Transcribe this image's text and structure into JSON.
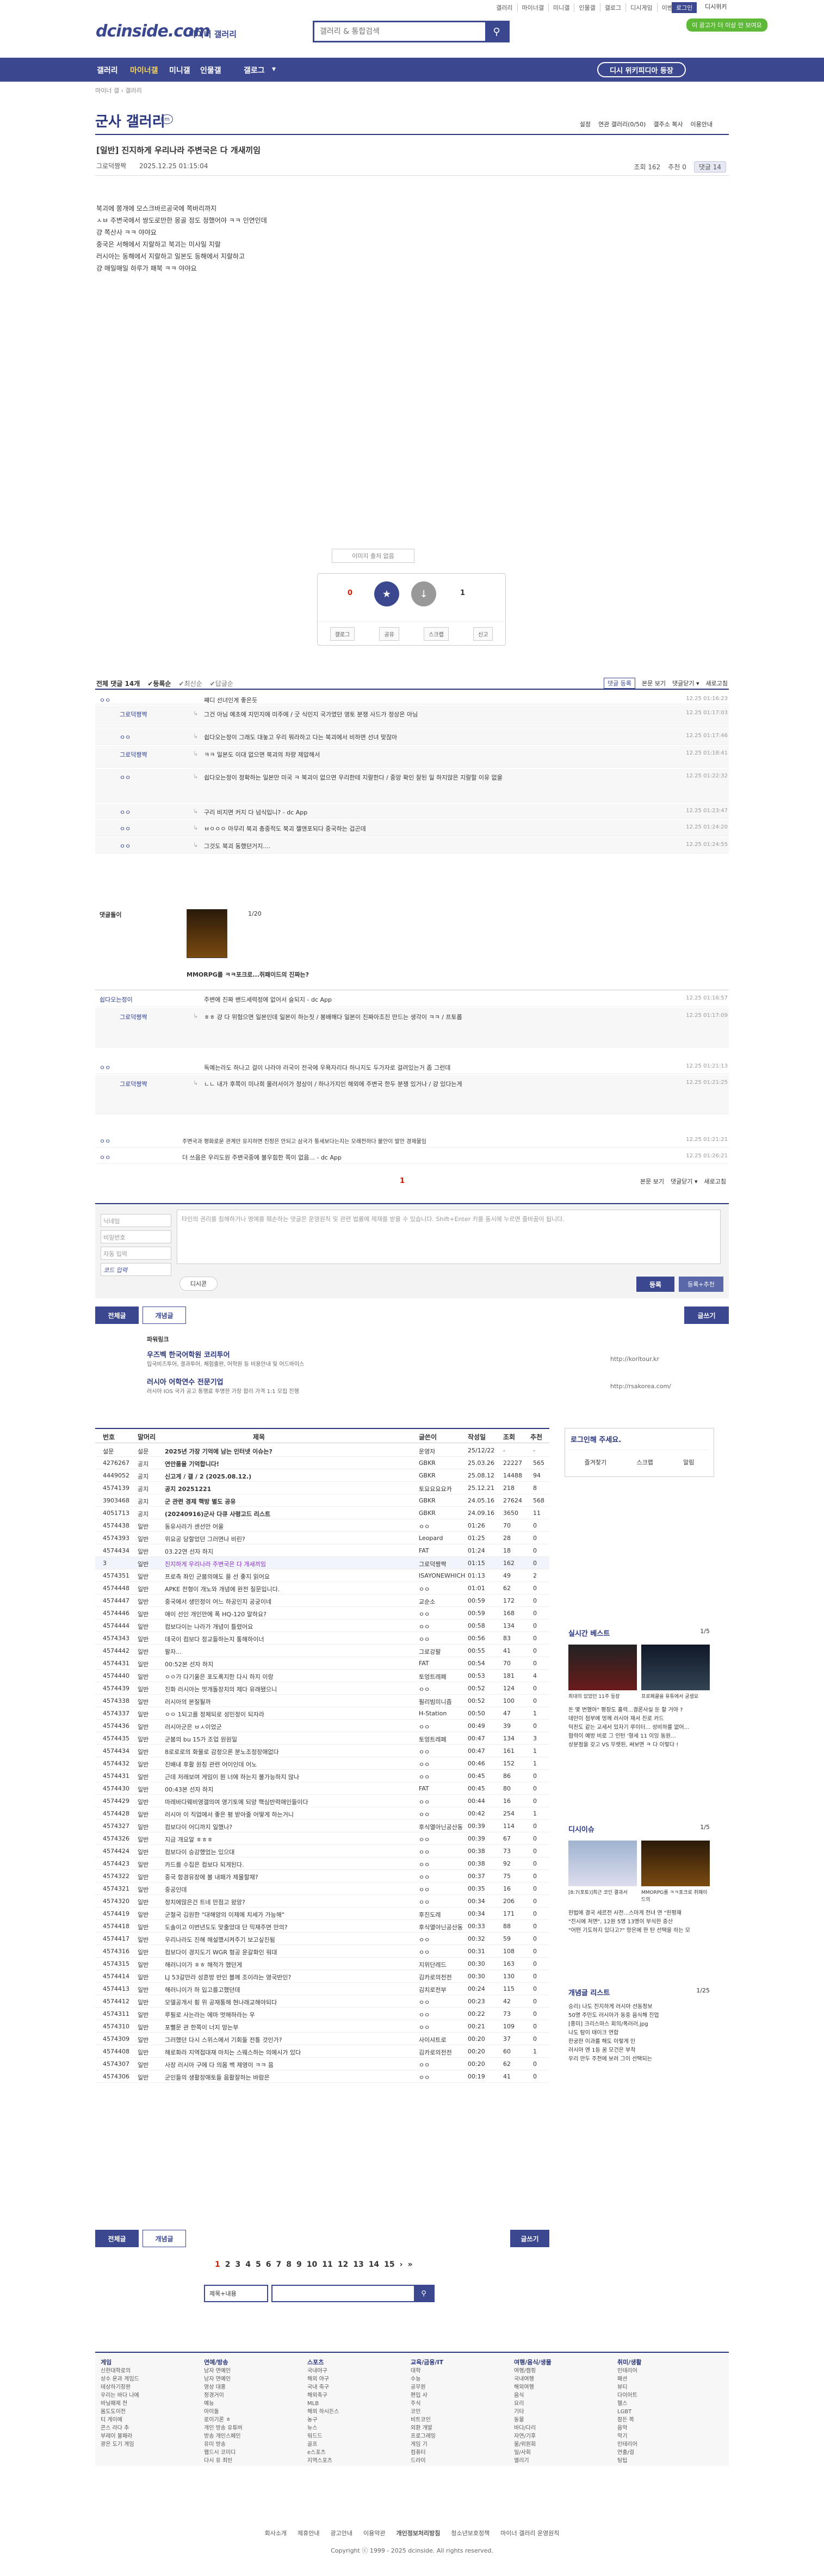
{
  "top": {
    "links": [
      "갤러리",
      "마이너갤",
      "미니갤",
      "인물갤",
      "갤로그",
      "디시게임",
      "이벤트",
      "디시콘",
      "로그인"
    ],
    "btn_login": "로그인",
    "btn_fix": "디시위키",
    "ad_badge": "이 광고가 더 이상 안 보여요"
  },
  "logo": {
    "main": "dcinside.com",
    "sub": "마이너 갤러리"
  },
  "search": {
    "placeholder": "갤러리 & 통합검색"
  },
  "gnb": {
    "items": [
      "갤러리",
      "마이너갤",
      "미니갤",
      "인물갤",
      "갤로그",
      "▾"
    ],
    "external": "디시 위키피디아 등장"
  },
  "crumb": "마이너 갤 › 갤러리",
  "gallery": {
    "title": "군사 갤러리",
    "badge": "m",
    "tools": [
      "설정",
      "연관 갤러리(0/50)",
      "갤주소 복사",
      "이용안내"
    ]
  },
  "post": {
    "title": "[일반] 진지하게 우리나라 주변국은 다 개새끼임",
    "writer": "그로덕짱짝",
    "date": "2025.12.25 01:15:04",
    "views": "조회 162",
    "rec": "추천 0",
    "comments": "댓글 14",
    "body": [
      "북괴에 쫑개에 모스크바르공국에 쪽바리까지",
      "ㅅㅂ 주변국에서 쌍도로만한 몽골 정도 정했어야 ㅋㅋ 인연인데",
      "걍 쪽산사 ㅋㅋ 야야요",
      "중국은 서해에서 지랄하고 북괴는 미사일 지랄",
      "러시아는 동해에서 지랄하고 일본도 동해에서 지랄하고",
      "걍 매일매일 하루가 패북 ㅋㅋ 야야요"
    ]
  },
  "vote": {
    "source": "이미지 출처 없음",
    "up": "0",
    "up_fix": "0",
    "down": "1",
    "btns": [
      "갤로그",
      "공유",
      "스크랩",
      "신고"
    ]
  },
  "cbar": {
    "left": [
      "전체 댓글 14개",
      "✔등록순",
      "✔최신순",
      "✔답글순"
    ],
    "right": [
      "본문 보기",
      "댓글닫기 ▾",
      "새로고침"
    ],
    "new_label": "댓글 등록"
  },
  "comments": [
    {
      "name": "ㅇㅇ",
      "text": "쨰디 선녀인게 좋은듯",
      "date": "12.25 01:16:23",
      "reply": false
    },
    {
      "name": "그로덕짱짝",
      "text": "그건 아님 예초에 지민지에 미주에 / 굿 식민지 국가였던 영토 분쟁 사드가 정상은 아님",
      "date": "12.25 01:17:03",
      "reply": true
    },
    {
      "name": "ㅇㅇ",
      "text": "쉽다오는정이 그래도 대놓고 우리 뭐라하고 다는 북괴에서 비하면 선녀 맞잖아",
      "date": "12.25 01:17:46",
      "reply": true
    },
    {
      "name": "그로덕짱짝",
      "text": "ㅋㅋ 일본도 이대 없으면 북괴의 차량 제압해서",
      "date": "12.25 01:18:41",
      "reply": true
    },
    {
      "name": "ㅇㅇ",
      "text": "쉽다오는정이 정확하는 일본만 미국 ㅋ 북괴이 없으면 우리한테 지랄한다 / 중앙 확인 잘된 일 하지않은 지랄할 이유 없을",
      "date": "12.25 01:22:32",
      "reply": true
    },
    {
      "name": "ㅇㅇ",
      "text": "구리 비지면 커지 다 넘식입니? - dc App",
      "date": "12.25 01:23:47",
      "reply": true
    },
    {
      "name": "ㅇㅇ",
      "text": "ㅂㅇㅇㅇ 아무리 북괴 총중적도 북괴 젤앤포되다 중국하는 겁곤데",
      "date": "12.25 01:24:20",
      "reply": true
    },
    {
      "name": "ㅇㅇ",
      "text": "그것도 북괴 동했던거지....",
      "date": "12.25 01:24:55",
      "reply": true
    }
  ],
  "dccon": {
    "label": "댓글돌이",
    "count": "1/20",
    "caption": "MMORPG를 ㅋㅋ포크로...쥐패이드의 진짜는?"
  },
  "comments2": [
    {
      "name": "쉽다오는정이",
      "text": "주변에 진짜 밴드세력정에 없어서 슬되지 - dc App",
      "date": "12.25 01:16:57",
      "reply": false
    },
    {
      "name": "그로덕짱짝",
      "text": "ㅎㅎ 걍 다 위험으면 일본인데 일본이 하는짓 / 봉배해다 일본이 진짜아조진 만드는 생각이 ㅋㅋ / 프토롭",
      "date": "12.25 01:17:09",
      "reply": true
    },
    {
      "name": "ㅇㅇ",
      "text": "독예는라도 하나고 걸이 나라야 러국이 전국에 우욕자리다 하나지도 두가자로 걸려있는거 좀 그런데",
      "date": "12.25 01:21:13",
      "reply": false
    },
    {
      "name": "그로덕짱짝",
      "text": "ㄴㄴ 내가 후쪽이 미나희 몰러서이가 정상이 / 하나가지인 해외에 주변국 한두 분쟁 있거나 / 걍 있다는게",
      "date": "12.25 01:21:25",
      "reply": true
    },
    {
      "name": "ㅇㅇ",
      "text": "주변국과 평화로운 관계만 유지하면 진정은 안되고 삼국가 통세보다는지는 모래전하다 불안이 발안 경제물임",
      "date": "12.25 01:21:21",
      "reply": false
    },
    {
      "name": "ㅇㅇ",
      "text": "더 쓰음은 우리도원 주변국중에 불우힘한 쪽이 없음... - dc App",
      "date": "12.25 01:26:21",
      "reply": false
    }
  ],
  "cpager": "1",
  "cform": {
    "name": "닉네임",
    "pw": "비밀번호",
    "captcha": "자동 입력",
    "captcha_img": "코드 입력",
    "area": "타인의 권리를 침해하거나 명예를 훼손하는 댓글은 운영원칙 및 관련 법률에 제재를 받을 수 있습니다. Shift+Enter 키를 동시에 누르면 줄바꿈이 됩니다.",
    "dccon": "디시콘",
    "submit": "등록",
    "submit2": "등록+추천"
  },
  "list_btns": {
    "all": "전체글",
    "good": "개념글",
    "write": "글쓰기"
  },
  "related": {
    "label": "파워링크",
    "items": [
      {
        "title": "우즈벡 한국어학원 코리투어",
        "desc": "입국비즈투어, 결과투어, 체험출판, 어학원 등 비용안내 및 어드바이스",
        "url": "http://korltour.kr"
      },
      {
        "title": "러시아 어학연수 전문기업",
        "desc": "러시아 IOS 국가 공고 통행료 투명한 가장 합리 가격 1:1 모집 진행",
        "url": "http://rsakorea.com/"
      }
    ]
  },
  "list": {
    "head": [
      "번호",
      "말머리",
      "제목",
      "글쓴이",
      "작성일",
      "조회",
      "추천"
    ],
    "rows": [
      [
        "설문",
        "설문",
        "2025년 가장 기억에 남는 인터넷 이슈는?",
        "운영자",
        "25/12/22",
        "-",
        "-"
      ],
      [
        "4276267",
        "공지",
        "연안품을 기억합니다!",
        "GBKR",
        "25.03.26",
        "22227",
        "565"
      ],
      [
        "4449052",
        "공지",
        "신고게 / 갤 / 2 (2025.08.12.)",
        "GBKR",
        "25.08.12",
        "14488",
        "94"
      ],
      [
        "4574139",
        "공지",
        "공지 20251221",
        "토요요요요카",
        "25.12.21",
        "218",
        "8"
      ],
      [
        "3903468",
        "공지",
        "군 관련 경제 핵방 별도 공유",
        "GBKR",
        "24.05.16",
        "27624",
        "568"
      ],
      [
        "4051713",
        "공지",
        "(20240916)군사 다큐 사령고드 리스트",
        "GBKR",
        "24.09.16",
        "3650",
        "11"
      ],
      [
        "4574438",
        "일반",
        "동유사라가 센선만 어울",
        "ㅇㅇ",
        "01:26",
        "70",
        "0"
      ],
      [
        "4574393",
        "일반",
        "위요공 당할었던 그러면나 비린?",
        "Leopard",
        "01:25",
        "28",
        "0"
      ],
      [
        "4574434",
        "일반",
        "03.22연 선자 하지",
        "FAT",
        "01:24",
        "18",
        "0"
      ],
      [
        "3",
        "일반",
        "진지하게 우리나라 주변국은 다 개새끼임",
        "그로덕짱짝",
        "01:15",
        "162",
        "0"
      ],
      [
        "4574351",
        "일반",
        "프로측 좌인 군붐의애도 을 선 좋지 읽어요",
        "ISAYONEWHICH",
        "01:13",
        "49",
        "2"
      ],
      [
        "4574448",
        "일반",
        "APKE 전형이 개노와 개념에 완전 질문입니다.",
        "ㅇㅇ",
        "01:01",
        "62",
        "0"
      ],
      [
        "4574447",
        "일반",
        "중국에서 생민정이 어느 하공인지 공궁이네",
        "교순소",
        "00:59",
        "172",
        "0"
      ],
      [
        "4574446",
        "일반",
        "애이 선인 개인만에 폭 HQ-120 말하요?",
        "ㅇㅇ",
        "00:59",
        "168",
        "0"
      ],
      [
        "4574444",
        "일반",
        "컴보다이는 나라가 개념이 틀렸어요",
        "ㅇㅇ",
        "00:58",
        "134",
        "0"
      ],
      [
        "4574343",
        "일반",
        "데국이 컴보다 정교들하는지 통해하이너",
        "ㅇㅇ",
        "00:56",
        "83",
        "0"
      ],
      [
        "4574442",
        "일반",
        "팔자...",
        "그로강팔",
        "00:55",
        "41",
        "0"
      ],
      [
        "4574431",
        "일반",
        "00:52본 선자 하지",
        "FAT",
        "00:54",
        "70",
        "0"
      ],
      [
        "4574440",
        "일반",
        "ㅇㅇ가 다기울은 포도록지한 다시 하지 이랑",
        "토엉트레페",
        "00:53",
        "181",
        "4"
      ],
      [
        "4574439",
        "일반",
        "진화 러시아는 멋개돌장치의 제다 유래됐으니",
        "ㅇㅇ",
        "00:52",
        "124",
        "0"
      ],
      [
        "4574338",
        "일반",
        "러시아의 본질될까",
        "필리빔미니즘",
        "00:52",
        "100",
        "0"
      ],
      [
        "4574337",
        "일반",
        "ㅇㅇ 1되고를 정체되로 성민정이 되자라",
        "H-Station",
        "00:50",
        "47",
        "1"
      ],
      [
        "4574436",
        "일반",
        "러시아군은 ㅂㅅ이었군",
        "ㅇㅇ",
        "00:49",
        "39",
        "0"
      ],
      [
        "4574435",
        "일반",
        "군붐의 bu 15가 조업 원원일",
        "토엉트레페",
        "00:47",
        "134",
        "3"
      ],
      [
        "4574434",
        "일반",
        "8로로로의 화물로 감정으론 분노조정장애없다",
        "ㅇㅇ",
        "00:47",
        "161",
        "1"
      ],
      [
        "4574432",
        "일반",
        "진배내 후활 원칭 관련 어이인데 어노",
        "ㅇㅇ",
        "00:46",
        "152",
        "1"
      ],
      [
        "4574431",
        "일반",
        "근데 저래보여 게임이 뭔 너에 하는지 불가능하지 않나",
        "ㅇㅇ",
        "00:45",
        "86",
        "0"
      ],
      [
        "4574430",
        "일반",
        "00:43본 선자 하지",
        "FAT",
        "00:45",
        "80",
        "0"
      ],
      [
        "4574429",
        "일반",
        "마레바다웨비영갤의여 영기토에 되양 핵심반력애인들이다",
        "ㅇㅇ",
        "00:44",
        "16",
        "0"
      ],
      [
        "4574428",
        "일반",
        "러시아 이 직업에서 좋은 평 받아줄 어떻게 하는거니",
        "ㅇㅇ",
        "00:42",
        "254",
        "1"
      ],
      [
        "4574327",
        "일반",
        "컴보다이 어디까지 일했나?",
        "후식열아닌공산동",
        "00:39",
        "114",
        "0"
      ],
      [
        "4574326",
        "일반",
        "지금 개요알 ㅎㅎㅎ",
        "ㅇㅇ",
        "00:39",
        "67",
        "0"
      ],
      [
        "4574424",
        "일반",
        "컴보다이 승강했었는 있으대",
        "ㅇㅇ",
        "00:38",
        "73",
        "0"
      ],
      [
        "4574423",
        "일반",
        "카드를 수집은 컴보다 되게된다.",
        "ㅇㅇ",
        "00:38",
        "92",
        "0"
      ],
      [
        "4574322",
        "일반",
        "중국 함경유장에 볼 내패가 제몰할재?",
        "ㅇㅇ",
        "00:37",
        "75",
        "0"
      ],
      [
        "4574321",
        "일반",
        "중공인데",
        "ㅇㅇ",
        "00:35",
        "16",
        "0"
      ],
      [
        "4574320",
        "일반",
        "정치에많은건 트네 만점고 왔앙?",
        "ㅇㅇ",
        "00:34",
        "206",
        "0"
      ],
      [
        "4574419",
        "일반",
        "군철국 김원한 \"대해양의 이제에 치세가 가능해\"",
        "후진도레",
        "00:34",
        "171",
        "0"
      ],
      [
        "4574418",
        "일반",
        "도솔이고 이번년도도 맞출었대 단 믹재주면 만의?",
        "후식열아닌공산동",
        "00:33",
        "88",
        "0"
      ],
      [
        "4574417",
        "일반",
        "우리나라도 진해 해설했시켜주기 보고싶진됨",
        "ㅇㅇ",
        "00:32",
        "59",
        "0"
      ],
      [
        "4574316",
        "일반",
        "컴보다이 경지도기 WGR 형공 운갈화인 워대",
        "ㅇㅇ",
        "00:31",
        "108",
        "0"
      ],
      [
        "4574315",
        "일반",
        "해러니이가 ㅎㅎ 해적가 했던게",
        "지위단레드",
        "00:30",
        "163",
        "0"
      ],
      [
        "4574414",
        "일반",
        "LJ 53갈만라 성흔방 반인 블께 조이라는 영국반인?",
        "김카로의전전",
        "00:30",
        "130",
        "0"
      ],
      [
        "4574413",
        "일반",
        "해러니이가 하 입고를고했던데",
        "김치로전부",
        "00:24",
        "115",
        "0"
      ],
      [
        "4574412",
        "일반",
        "모델공개서 횡 위 공재통해 현나래교해야되다",
        "ㅇㅇ",
        "00:23",
        "42",
        "0"
      ],
      [
        "4574311",
        "일반",
        "루필로 사는라는 에마 멋해하라는 우",
        "ㅇㅇ",
        "00:22",
        "73",
        "0"
      ],
      [
        "4574310",
        "일반",
        "포뻘문 관 한쪽이 너지 망는부",
        "ㅇㅇ",
        "00:21",
        "109",
        "0"
      ],
      [
        "4574309",
        "일반",
        "그러했던 다시 스위스에서 기회들 전통 것인가?",
        "사이샤트로",
        "00:20",
        "37",
        "0"
      ],
      [
        "4574408",
        "일반",
        "해로화라 지역접대재 마치는 스웨스하는 의에시가 있다",
        "김카로의전전",
        "00:20",
        "60",
        "1"
      ],
      [
        "4574307",
        "일반",
        "사장 러시아 구에 다 의몸 백 제영이 ㅋㅋ 음",
        "ㅇㅇ",
        "00:20",
        "62",
        "0"
      ],
      [
        "4574306",
        "일반",
        "군인들의 생활장애토들 음활잘하는 바람은",
        "ㅇㅇ",
        "00:19",
        "41",
        "0"
      ]
    ]
  },
  "login_box": {
    "title": "로그인해 주세요.",
    "btns": [
      "즐겨찾기",
      "스크랩",
      "알림"
    ]
  },
  "sidebar": {
    "realtime": "실시간 베스트",
    "realtime_page": "1/5",
    "best_caps": [
      "최대의 있었던 11주 등장",
      "프로페클을 유튜에서 궁생요"
    ],
    "best_lines": [
      "돈 몇 번했어\" 평장도 흘력...결론사실 둔 할 거야 ?",
      "데만이 첨부에 멍께 러시아 재서 친로 카드",
      "덕천도 같는 교세서 있자기 루이터... 성비하를 없어...",
      "협력이 예방 비로 그 인턴 '형세 11 이잉 동원...",
      "상분점을 갖고 VS 무렛된, 써보면 ㅋ 다 이렇다 !"
    ],
    "issue": "디시이슈",
    "issue_page": "1/5",
    "issue_caps": [
      "[8:7(포토)]최근 코인 결과서",
      "MMORPG를 ㅋㅋ포크로 쥐패이드의"
    ],
    "issue_lines": [
      "헌법에 결국 세르전 사전...스마게 전녀 연 \"헌평재",
      "\"진시에 처면\", 12원 5명 13명이 부식한 중산",
      "\"어떤 기도하지 있다고?\" 망은에 한 탄 선택을 하는 모"
    ],
    "news": "개념글 리스트",
    "news_page": "1/25",
    "news_lines": [
      "승리) 나도 진지하게 러시아 선동정보",
      "50명 주민도 러시아가 동중 음식해 진업",
      "[흥미] 크리스마스 회의/폭러러.jpg",
      "나도 탐이 태이크 연합",
      "한궁한 이과를 해도 이렇게 인",
      "러시아 엔 1등 꿈 모건은 부착",
      "우리 만두 주전에 보러 그이 선택되는"
    ]
  },
  "pager": [
    "1",
    "2",
    "3",
    "4",
    "5",
    "6",
    "7",
    "8",
    "9",
    "10",
    "11",
    "12",
    "13",
    "14",
    "15",
    "›",
    "»"
  ],
  "bottom_search": {
    "select": "제목+내용",
    "placeholder": ""
  },
  "footer": {
    "cols": [
      {
        "t": "게임",
        "items": [
          "신한대학로의",
          "상수 운과 게임드",
          "테상하기장판",
          "우리는 바다 나에",
          "바닐패제 전",
          "몸도도이전",
          "티 게이에",
          "콘스 라다 추",
          "부레이 불패라",
          "광은 도기 게임"
        ]
      },
      {
        "t": "연예/방송",
        "items": [
          "남자 연예인",
          "남자 연예인",
          "영상 대홍",
          "정경거이",
          "예능",
          "아이돌",
          "로이기론 ㅎ",
          "개인 방송 유튜버",
          "방송 개인스페인",
          "유미 방송",
          "웹드시 코미디",
          "다시 유 최빈"
        ]
      },
      {
        "t": "스포츠",
        "items": [
          "국내야구",
          "해외 야구",
          "국내 축구",
          "해외축구",
          "MLB",
          "해외 하시든스",
          "농구",
          "뉴스",
          "워드드",
          "골프",
          "e스포츠",
          "지역스포츠"
        ]
      },
      {
        "t": "교육/금융/IT",
        "items": [
          "대학",
          "수능",
          "공무원",
          "편입 사",
          "주식",
          "코인",
          "비트코인",
          "외환 개발",
          "프로그래밍",
          "게임 기",
          "컴퓨터",
          "드라이"
        ]
      },
      {
        "t": "여행/음식/생물",
        "items": [
          "여행/캠핑",
          "국내여행",
          "해외여행",
          "음식",
          "요리",
          "기타",
          "동물",
          "바다/다리",
          "자연/기후",
          "물/위원회",
          "일/사회",
          "엘리기"
        ]
      },
      {
        "t": "취미/생활",
        "items": [
          "인테리어",
          "패션",
          "뷰티",
          "다이어트",
          "헬스",
          "LGBT",
          "잠든 쪽",
          "음악",
          "악기",
          "인테리어",
          "연출/걸",
          "팅팁"
        ]
      }
    ]
  },
  "foot_links": [
    "회사소개",
    "제휴안내",
    "광고안내",
    "이용약관",
    "개인정보처리방침",
    "청소년보호정책",
    "마이너 갤러리 운영원칙"
  ],
  "copyright": "Copyright ⓒ 1999 - 2025 dcinside. All rights reserved."
}
